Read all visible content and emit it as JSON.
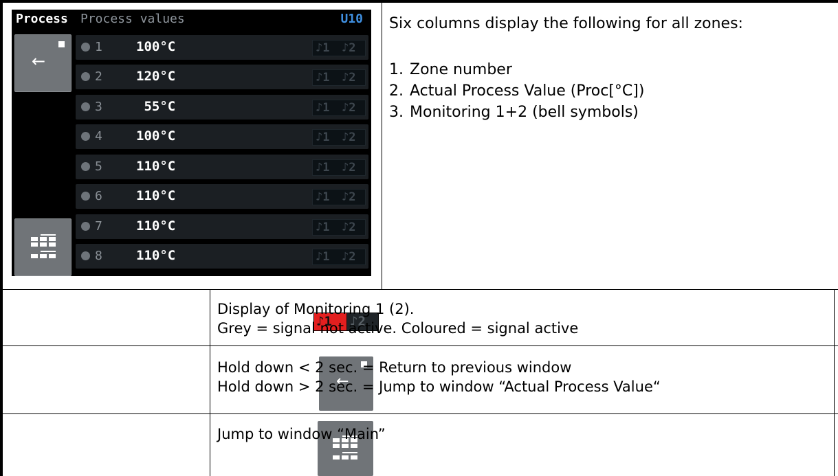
{
  "device": {
    "title": "Process",
    "subtitle": "Process values",
    "unit_tag": "U10",
    "back_icon": "back-arrow-icon",
    "main_icon": "main-grid-icon",
    "bell_labels": [
      "♪1",
      "♪2"
    ],
    "zones": [
      {
        "zone": "1",
        "value": "100°C"
      },
      {
        "zone": "2",
        "value": "120°C"
      },
      {
        "zone": "3",
        "value": " 55°C"
      },
      {
        "zone": "4",
        "value": "100°C"
      },
      {
        "zone": "5",
        "value": "110°C"
      },
      {
        "zone": "6",
        "value": "110°C"
      },
      {
        "zone": "7",
        "value": "110°C"
      },
      {
        "zone": "8",
        "value": "110°C"
      }
    ]
  },
  "description": {
    "intro": "Six columns display the following for all zones:",
    "items": [
      {
        "num": "1.",
        "text": "Zone number"
      },
      {
        "num": "2.",
        "text": "Actual Process Value (Proc[°C])"
      },
      {
        "num": "3.",
        "text": "Monitoring 1+2  (bell symbols)"
      }
    ]
  },
  "legend": [
    {
      "icon": "monitoring-bell-icon",
      "lines": [
        "Display of Monitoring 1 (2).",
        "Grey = signal not active. Coloured = signal active"
      ]
    },
    {
      "icon": "back-arrow-icon",
      "lines": [
        "Hold down < 2 sec. = Return to previous window",
        "Hold down > 2 sec. = Jump to window “Actual Process Value“"
      ]
    },
    {
      "icon": "main-grid-icon",
      "lines": [
        "Jump to window “Main”"
      ]
    }
  ],
  "colors": {
    "screen_bg": "#000000",
    "row_bg": "#1b1f23",
    "button_grey": "#707478",
    "unit_blue": "#3f8fe0",
    "alarm_red": "#e31f1f"
  }
}
